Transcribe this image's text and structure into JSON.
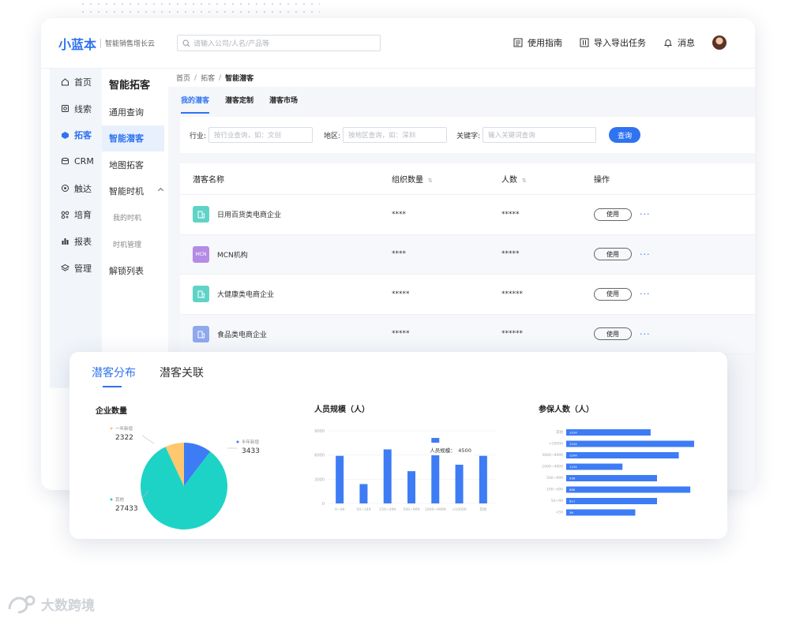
{
  "header": {
    "logo": "小蓝本",
    "slogan": "智能销售增长云",
    "search_placeholder": "请输入公司/人名/产品等",
    "actions": [
      {
        "label": "使用指南",
        "icon": "guide-icon"
      },
      {
        "label": "导入导出任务",
        "icon": "import-export-icon"
      },
      {
        "label": "消息",
        "icon": "bell-icon"
      }
    ]
  },
  "nav": [
    {
      "label": "首页",
      "icon": "home-icon"
    },
    {
      "label": "线索",
      "icon": "leads-icon"
    },
    {
      "label": "拓客",
      "icon": "prospect-icon",
      "active": true
    },
    {
      "label": "CRM",
      "icon": "crm-icon"
    },
    {
      "label": "触达",
      "icon": "reach-icon"
    },
    {
      "label": "培育",
      "icon": "nurture-icon"
    },
    {
      "label": "报表",
      "icon": "report-icon"
    },
    {
      "label": "管理",
      "icon": "manage-icon"
    }
  ],
  "subnav": {
    "title": "智能拓客",
    "items": [
      "通用查询",
      "智能潜客",
      "地图拓客",
      "智能时机",
      "我的时机",
      "时机管理",
      "解锁列表"
    ]
  },
  "breadcrumb": [
    "首页",
    "拓客",
    "智能潜客"
  ],
  "tabs": [
    "我的潜客",
    "潜客定制",
    "潜客市场"
  ],
  "filters": {
    "industry_label": "行业:",
    "industry_placeholder": "按行业查询，如：文创",
    "region_label": "地区:",
    "region_placeholder": "按地区查询，如：深圳",
    "keyword_label": "关键字:",
    "keyword_placeholder": "输入关键词查询",
    "query_button": "查询"
  },
  "table": {
    "columns": [
      "潜客名称",
      "组织数量",
      "人数",
      "操作"
    ],
    "use_label": "使用",
    "rows": [
      {
        "name": "日用百货类电商企业",
        "orgs": "****",
        "people": "*****",
        "icon_text": "",
        "color": "#5fd3c8"
      },
      {
        "name": "MCN机构",
        "orgs": "****",
        "people": "*****",
        "icon_text": "MCN",
        "color": "#b48be6"
      },
      {
        "name": "大健康类电商企业",
        "orgs": "*****",
        "people": "******",
        "icon_text": "",
        "color": "#5fd3c8"
      },
      {
        "name": "食品类电商企业",
        "orgs": "*****",
        "people": "******",
        "icon_text": "",
        "color": "#8fa8ee"
      }
    ]
  },
  "panel": {
    "tabs": [
      "潜客分布",
      "潜客关联"
    ]
  },
  "chart_data": [
    {
      "type": "pie",
      "title": "企业数量",
      "slices": [
        {
          "label": "半年新增",
          "value": 3433,
          "color": "#3d7cf5"
        },
        {
          "label": "其他",
          "value": 27433,
          "color": "#1dd3c6"
        },
        {
          "label": "一年新增",
          "value": 2322,
          "color": "#ffc76e"
        }
      ]
    },
    {
      "type": "bar",
      "title": "人员规模（人）",
      "categories": [
        "0~49",
        "50~149",
        "150~499",
        "500~999",
        "1000~9999",
        ">10000",
        "其他"
      ],
      "values": [
        5900,
        2400,
        6700,
        4000,
        7200,
        4800,
        5900
      ],
      "ylim": [
        0,
        9000
      ],
      "yticks": [
        0,
        3000,
        6000,
        9000
      ],
      "tooltip": {
        "label": "人员规模：",
        "value": "4500",
        "category_index": 4
      },
      "color": "#3d7cf5"
    },
    {
      "type": "bar",
      "orientation": "horizontal",
      "title": "参保人数（人）",
      "categories": [
        "其他",
        ">10000",
        "5000~9999",
        "1000~4999",
        "500~999",
        "100~499",
        "50~99",
        "<50"
      ],
      "values": [
        1224,
        1244,
        1204,
        1234,
        936,
        886,
        811,
        36
      ],
      "lengths": [
        0.66,
        1.0,
        0.88,
        0.44,
        0.71,
        0.97,
        0.71,
        0.54
      ],
      "color": "#3d7cf5"
    }
  ],
  "watermark": "大数跨境"
}
